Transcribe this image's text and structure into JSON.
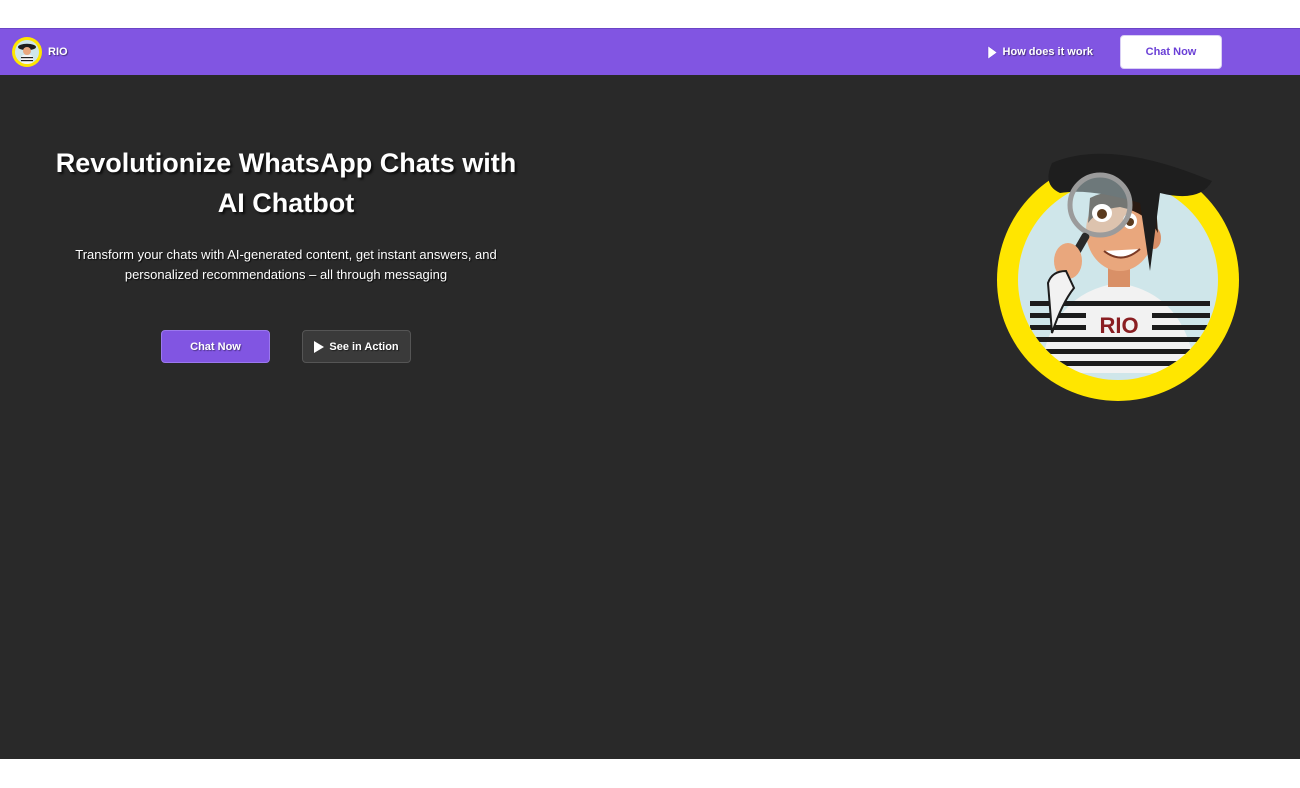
{
  "brand": {
    "name": "RIO",
    "icon": "mascot-avatar-icon"
  },
  "nav": {
    "how_it_works": "How does it work",
    "chat_now": "Chat Now"
  },
  "hero": {
    "title_line1": "Revolutionize WhatsApp Chats with",
    "title_line2": "AI Chatbot",
    "subtitle_line1": "Transform your chats with AI-generated content, get instant answers, and",
    "subtitle_line2": "personalized recommendations – all through messaging",
    "primary_button": "Chat Now",
    "secondary_button": "See in Action"
  },
  "mascot": {
    "shirt_text": "RIO",
    "icon": "detective-mascot-illustration"
  },
  "colors": {
    "brand_purple": "#8155e2",
    "hero_bg": "#292929",
    "mascot_ring": "#ffe600",
    "mascot_bg": "#cfe6ea"
  }
}
